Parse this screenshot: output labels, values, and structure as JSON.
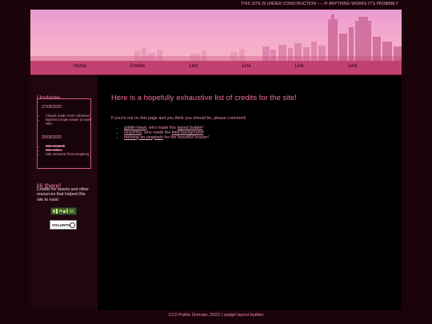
{
  "top_notice": "THIS SITE IS UNDER CONSTRUCTION ---- IF ANYTHING WORKS IT'S PROBABLY",
  "nav": {
    "items": [
      {
        "label": "Home"
      },
      {
        "label": "Credits"
      },
      {
        "label": "Link"
      },
      {
        "label": "Link"
      },
      {
        "label": "Link"
      },
      {
        "label": "Link"
      }
    ]
  },
  "sidebar": {
    "updates_title": "Updates",
    "updates": [
      {
        "date": "27/06/2025",
        "items": [
          {
            "text": "Visuals made more cohesive."
          },
          {
            "text": "Backend made easier to work with."
          }
        ]
      },
      {
        "date": "26/06/2025",
        "items": [
          {
            "text": "Site created!",
            "struck": true
          },
          {
            "text": "Site exits...",
            "struck": true
          },
          {
            "text": "Site removed from purgatory.",
            "struck": false
          }
        ]
      }
    ],
    "greeting_title": "Hi there!",
    "credits_blurb": "Credits for assets and other resources that helped this site to exist:",
    "badge_2_text": "VOLUNTOR"
  },
  "main": {
    "title": "Here is a hopefully exhaustive list of credits for the site!",
    "intro": "If you're not on this page and you think you should be, please comment!",
    "credits": [
      {
        "link": "goblin-heart",
        "text_before_link2": ", who made this ",
        "link2": "layout builder",
        "text_after": "!"
      },
      {
        "link": "vinyzinho",
        "text_before_link2": ", who made the ",
        "link2": "tiled background",
        "text_after": "!"
      },
      {
        "link": "mexong on unsplash",
        "text_before_link2": " for the beautiful header!",
        "link2": "",
        "text_after": ""
      }
    ]
  },
  "footer": "CC0 Public Domain, 2022 | sadgrl layout builder",
  "colors": {
    "page_background": "#1a0309",
    "nav_bar": "#c24170",
    "accent_pink": "#f06a9f",
    "sidebar_background": "#20060e"
  }
}
